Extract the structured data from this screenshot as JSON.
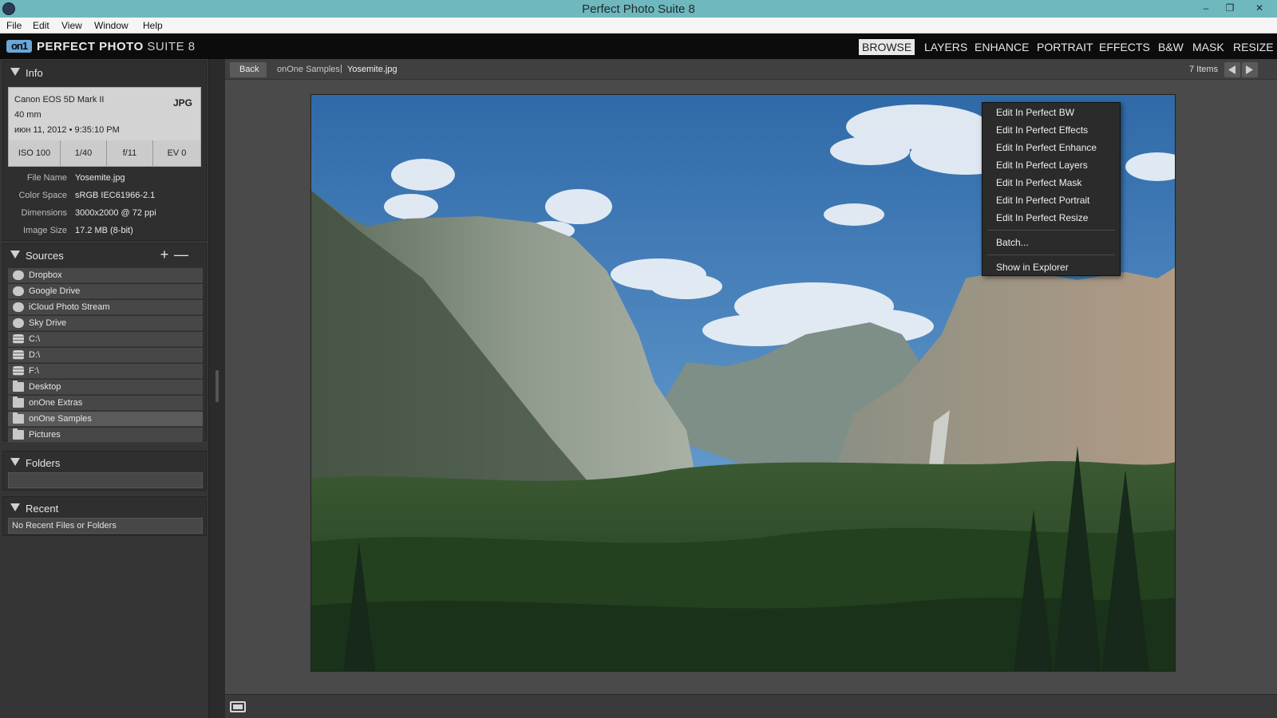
{
  "window": {
    "title": "Perfect Photo Suite 8",
    "minimize": "‒",
    "maximize": "❐",
    "close": "✕"
  },
  "menubar": [
    "File",
    "Edit",
    "View",
    "Window",
    "Help"
  ],
  "header": {
    "logo": "on1",
    "brand_bold": "PERFECT PHOTO",
    "brand_light": "SUITE 8",
    "modules": [
      "BROWSE",
      "LAYERS",
      "ENHANCE",
      "PORTRAIT",
      "EFFECTS",
      "B&W",
      "MASK",
      "RESIZE"
    ],
    "active_module": "BROWSE"
  },
  "info": {
    "title": "Info",
    "camera": "Canon EOS 5D Mark II",
    "focal": "40 mm",
    "date": "июн 11, 2012 • 9:35:10 PM",
    "format": "JPG",
    "exposure": [
      "ISO 100",
      "1/40",
      "f/11",
      "EV 0"
    ],
    "rows": [
      {
        "key": "File Name",
        "value": "Yosemite.jpg"
      },
      {
        "key": "Color Space",
        "value": "sRGB IEC61966-2.1"
      },
      {
        "key": "Dimensions",
        "value": "3000x2000 @ 72 ppi"
      },
      {
        "key": "Image Size",
        "value": "17.2 MB (8-bit)"
      }
    ]
  },
  "sources": {
    "title": "Sources",
    "add": "+",
    "remove": "—",
    "items": [
      {
        "label": "Dropbox",
        "icon": "dropbox-icon"
      },
      {
        "label": "Google Drive",
        "icon": "google-drive-icon"
      },
      {
        "label": "iCloud Photo Stream",
        "icon": "icloud-icon"
      },
      {
        "label": "Sky Drive",
        "icon": "skydrive-icon"
      },
      {
        "label": "C:\\",
        "icon": "drive-icon"
      },
      {
        "label": "D:\\",
        "icon": "drive-icon"
      },
      {
        "label": "F:\\",
        "icon": "drive-icon"
      },
      {
        "label": "Desktop",
        "icon": "folder-icon"
      },
      {
        "label": "onOne Extras",
        "icon": "folder-icon"
      },
      {
        "label": "onOne Samples",
        "icon": "folder-icon"
      },
      {
        "label": "Pictures",
        "icon": "folder-icon"
      }
    ],
    "selected": "onOne Samples"
  },
  "folders": {
    "title": "Folders"
  },
  "recent": {
    "title": "Recent",
    "empty_text": "No Recent Files or Folders"
  },
  "viewer": {
    "back": "Back",
    "crumb_folder": "onOne Samples",
    "crumb_sep": "|",
    "crumb_file": "Yosemite.jpg",
    "item_count": "7 Items"
  },
  "context_menu": {
    "edit_items": [
      "Edit In Perfect BW",
      "Edit In Perfect Effects",
      "Edit In Perfect Enhance",
      "Edit In Perfect Layers",
      "Edit In Perfect Mask",
      "Edit In Perfect Portrait",
      "Edit In Perfect Resize"
    ],
    "batch": "Batch...",
    "show_in_explorer": "Show in Explorer"
  },
  "colors": {
    "titlebar": "#6fb8bd",
    "header": "#0c0c0c",
    "panel": "#353535",
    "viewer": "#4a4a4a",
    "sky": "#3e78b8",
    "forest": "#2a4a25"
  }
}
